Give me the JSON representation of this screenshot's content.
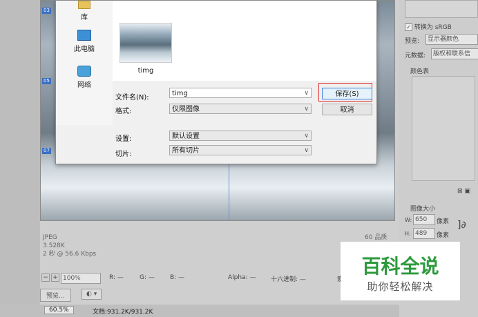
{
  "dialog": {
    "nav_items": [
      {
        "label": "库",
        "icon": "library-icon"
      },
      {
        "label": "此电脑",
        "icon": "computer-icon"
      },
      {
        "label": "网络",
        "icon": "network-icon"
      }
    ],
    "file": {
      "name": "timg"
    },
    "filename_label": "文件名(N):",
    "filename_value": "timg",
    "format_label": "格式:",
    "format_value": "仅限图像",
    "settings_label": "设置:",
    "settings_value": "默认设置",
    "slices_label": "切片:",
    "slices_value": "所有切片",
    "save_button": "保存(S)",
    "cancel_button": "取消"
  },
  "document": {
    "slice_labels": [
      "03",
      "05",
      "07"
    ],
    "info": {
      "format": "JPEG",
      "size": "3.528K",
      "time": "2 秒 @ 56.6 Kbps",
      "quality": "60 品质"
    }
  },
  "bottom_bar": {
    "zoom": "100%",
    "r": "R: —",
    "g": "G: —",
    "b": "B: —",
    "alpha": "Alpha: —",
    "hex": "十六进制: —",
    "extra": "索"
  },
  "bottom_bar2": {
    "preview_button": "预览..."
  },
  "status_bar": {
    "zoom": "60.5%",
    "doc": "文档:931.2K/931.2K"
  },
  "right_panel": {
    "convert_srgb": "转换为 sRGB",
    "preview_label": "预览:",
    "preview_value": "显示器颜色",
    "metadata_label": "元数据:",
    "metadata_value": "版权和联系信",
    "color_table": "颜色表",
    "image_size": "图像大小",
    "w_label": "W:",
    "w_value": "650",
    "h_label": "H:",
    "h_value": "489",
    "px": "像素"
  },
  "watermark": {
    "title": "百科全说",
    "subtitle": "助你轻松解决"
  },
  "colors": {
    "accent": "#3a6fc4",
    "watermark_green": "#2d9a3e",
    "highlight_red": "#e03030"
  }
}
